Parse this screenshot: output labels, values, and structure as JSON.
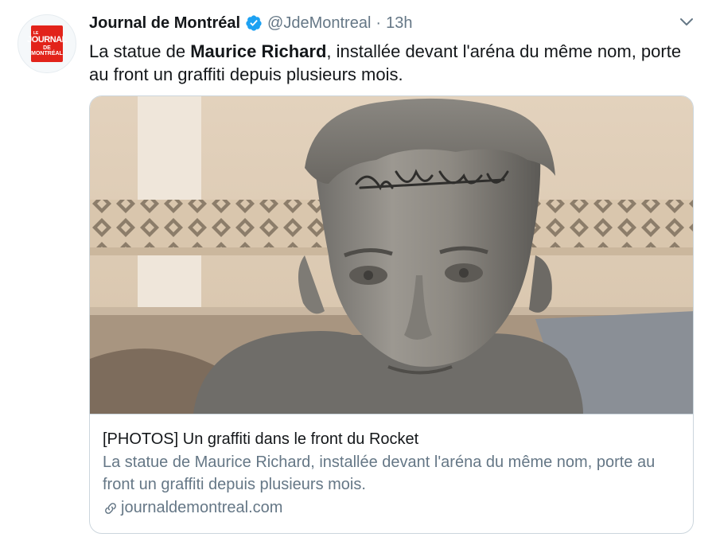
{
  "avatar": {
    "logo_top": "LE",
    "logo_main": "JOURNAL",
    "logo_sub": "DE MONTRÉAL",
    "icon": "newspaper-logo"
  },
  "tweet": {
    "author_name": "Journal de Montréal",
    "handle": "@JdeMontreal",
    "separator": "·",
    "time": "13h",
    "text_before": "La statue de ",
    "text_bold": "Maurice Richard",
    "text_after": ", installée devant l'aréna du même nom, porte au front un graffiti depuis plusieurs mois."
  },
  "card": {
    "title": "[PHOTOS] Un graffiti dans le front du Rocket",
    "description": "La statue de Maurice Richard, installée devant l'aréna du même nom, porte au front un graffiti depuis plusieurs mois.",
    "domain": "journaldemontreal.com",
    "image_icon": "statue-photo"
  },
  "colors": {
    "text": "#14171a",
    "secondary": "#657786",
    "border": "#ccd6dd",
    "verified": "#1da1f2",
    "brand": "#e2231a"
  }
}
